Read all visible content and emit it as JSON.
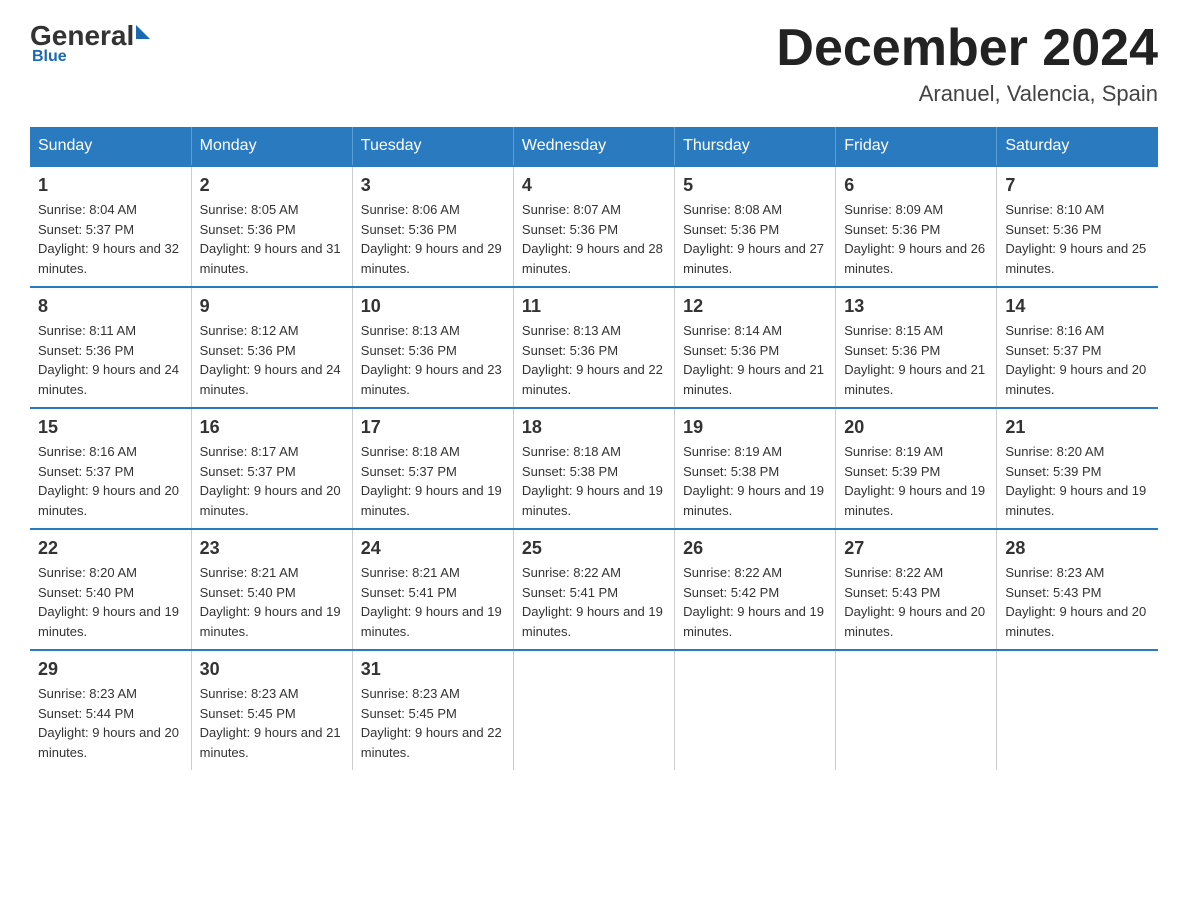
{
  "header": {
    "logo_general": "General",
    "logo_blue": "Blue",
    "month_title": "December 2024",
    "location": "Aranuel, Valencia, Spain"
  },
  "days_of_week": [
    "Sunday",
    "Monday",
    "Tuesday",
    "Wednesday",
    "Thursday",
    "Friday",
    "Saturday"
  ],
  "weeks": [
    [
      {
        "day": "1",
        "sunrise": "8:04 AM",
        "sunset": "5:37 PM",
        "daylight": "9 hours and 32 minutes."
      },
      {
        "day": "2",
        "sunrise": "8:05 AM",
        "sunset": "5:36 PM",
        "daylight": "9 hours and 31 minutes."
      },
      {
        "day": "3",
        "sunrise": "8:06 AM",
        "sunset": "5:36 PM",
        "daylight": "9 hours and 29 minutes."
      },
      {
        "day": "4",
        "sunrise": "8:07 AM",
        "sunset": "5:36 PM",
        "daylight": "9 hours and 28 minutes."
      },
      {
        "day": "5",
        "sunrise": "8:08 AM",
        "sunset": "5:36 PM",
        "daylight": "9 hours and 27 minutes."
      },
      {
        "day": "6",
        "sunrise": "8:09 AM",
        "sunset": "5:36 PM",
        "daylight": "9 hours and 26 minutes."
      },
      {
        "day": "7",
        "sunrise": "8:10 AM",
        "sunset": "5:36 PM",
        "daylight": "9 hours and 25 minutes."
      }
    ],
    [
      {
        "day": "8",
        "sunrise": "8:11 AM",
        "sunset": "5:36 PM",
        "daylight": "9 hours and 24 minutes."
      },
      {
        "day": "9",
        "sunrise": "8:12 AM",
        "sunset": "5:36 PM",
        "daylight": "9 hours and 24 minutes."
      },
      {
        "day": "10",
        "sunrise": "8:13 AM",
        "sunset": "5:36 PM",
        "daylight": "9 hours and 23 minutes."
      },
      {
        "day": "11",
        "sunrise": "8:13 AM",
        "sunset": "5:36 PM",
        "daylight": "9 hours and 22 minutes."
      },
      {
        "day": "12",
        "sunrise": "8:14 AM",
        "sunset": "5:36 PM",
        "daylight": "9 hours and 21 minutes."
      },
      {
        "day": "13",
        "sunrise": "8:15 AM",
        "sunset": "5:36 PM",
        "daylight": "9 hours and 21 minutes."
      },
      {
        "day": "14",
        "sunrise": "8:16 AM",
        "sunset": "5:37 PM",
        "daylight": "9 hours and 20 minutes."
      }
    ],
    [
      {
        "day": "15",
        "sunrise": "8:16 AM",
        "sunset": "5:37 PM",
        "daylight": "9 hours and 20 minutes."
      },
      {
        "day": "16",
        "sunrise": "8:17 AM",
        "sunset": "5:37 PM",
        "daylight": "9 hours and 20 minutes."
      },
      {
        "day": "17",
        "sunrise": "8:18 AM",
        "sunset": "5:37 PM",
        "daylight": "9 hours and 19 minutes."
      },
      {
        "day": "18",
        "sunrise": "8:18 AM",
        "sunset": "5:38 PM",
        "daylight": "9 hours and 19 minutes."
      },
      {
        "day": "19",
        "sunrise": "8:19 AM",
        "sunset": "5:38 PM",
        "daylight": "9 hours and 19 minutes."
      },
      {
        "day": "20",
        "sunrise": "8:19 AM",
        "sunset": "5:39 PM",
        "daylight": "9 hours and 19 minutes."
      },
      {
        "day": "21",
        "sunrise": "8:20 AM",
        "sunset": "5:39 PM",
        "daylight": "9 hours and 19 minutes."
      }
    ],
    [
      {
        "day": "22",
        "sunrise": "8:20 AM",
        "sunset": "5:40 PM",
        "daylight": "9 hours and 19 minutes."
      },
      {
        "day": "23",
        "sunrise": "8:21 AM",
        "sunset": "5:40 PM",
        "daylight": "9 hours and 19 minutes."
      },
      {
        "day": "24",
        "sunrise": "8:21 AM",
        "sunset": "5:41 PM",
        "daylight": "9 hours and 19 minutes."
      },
      {
        "day": "25",
        "sunrise": "8:22 AM",
        "sunset": "5:41 PM",
        "daylight": "9 hours and 19 minutes."
      },
      {
        "day": "26",
        "sunrise": "8:22 AM",
        "sunset": "5:42 PM",
        "daylight": "9 hours and 19 minutes."
      },
      {
        "day": "27",
        "sunrise": "8:22 AM",
        "sunset": "5:43 PM",
        "daylight": "9 hours and 20 minutes."
      },
      {
        "day": "28",
        "sunrise": "8:23 AM",
        "sunset": "5:43 PM",
        "daylight": "9 hours and 20 minutes."
      }
    ],
    [
      {
        "day": "29",
        "sunrise": "8:23 AM",
        "sunset": "5:44 PM",
        "daylight": "9 hours and 20 minutes."
      },
      {
        "day": "30",
        "sunrise": "8:23 AM",
        "sunset": "5:45 PM",
        "daylight": "9 hours and 21 minutes."
      },
      {
        "day": "31",
        "sunrise": "8:23 AM",
        "sunset": "5:45 PM",
        "daylight": "9 hours and 22 minutes."
      },
      null,
      null,
      null,
      null
    ]
  ]
}
